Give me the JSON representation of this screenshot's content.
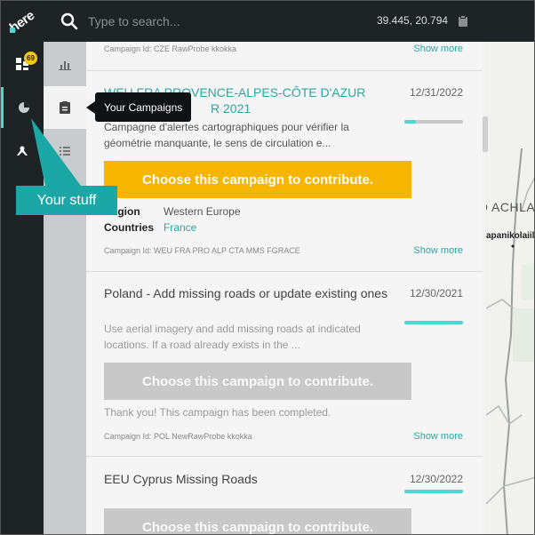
{
  "topbar": {
    "logo_text": "here",
    "search_placeholder": "Type to search...",
    "coordinates": "39.445, 20.794"
  },
  "rail": {
    "badge_count": "69"
  },
  "tooltip": {
    "text": "Your Campaigns"
  },
  "callout": {
    "text": "Your stuff"
  },
  "map": {
    "label_1": "O ACHLA",
    "label_2": "apanikolaiil"
  },
  "panel": {
    "top_card": {
      "campaign_id": "Campaign Id: CZE RawProbe kkokka",
      "show_more": "Show more"
    },
    "cards": [
      {
        "title_line_1": "WEU FRA PROVENCE-ALPES-CÔTE D'AZUR",
        "title_line_2": "R 2021",
        "date": "12/31/2022",
        "progress": 0.2,
        "description": "Campagne d'alertes cartographiques pour vérifier la géométrie manquante, le sens de circulation e...",
        "cta": "Choose this campaign to contribute.",
        "region_label": "Region",
        "region_value": "Western Europe",
        "countries_label": "Countries",
        "countries_value": "France",
        "campaign_id": "Campaign Id: WEU FRA PRO ALP CTA MMS FGRACE",
        "show_more": "Show more"
      },
      {
        "title": "Poland - Add missing roads or update existing ones",
        "date": "12/30/2021",
        "progress": 1.0,
        "description": "Use aerial imagery and add missing roads at indicated locations. If a road already exists in the ...",
        "cta": "Choose this campaign to contribute.",
        "completed_text": "Thank you! This campaign has been completed.",
        "campaign_id": "Campaign Id: POL NewRawProbe kkokka",
        "show_more": "Show more"
      },
      {
        "title": "EEU Cyprus Missing Roads",
        "date": "12/30/2022",
        "progress": 1.0,
        "cta": "Choose this campaign to contribute."
      }
    ]
  },
  "colors": {
    "dark": "#1e2426",
    "teal": "#48dad0",
    "teal_text": "#2aa7a0",
    "cta_active": "#f7b500",
    "cta_disabled": "#c8c8c8",
    "badge": "#f7c515"
  }
}
